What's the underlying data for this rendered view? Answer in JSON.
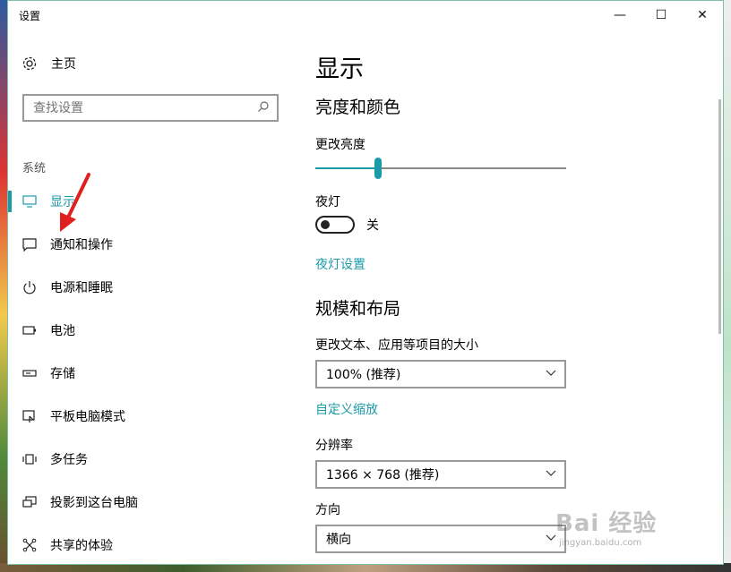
{
  "window": {
    "title": "设置",
    "controls": {
      "minimize": "—",
      "maximize": "☐",
      "close": "✕"
    }
  },
  "nav": {
    "home": {
      "label": "主页",
      "icon": "gear-icon"
    },
    "search": {
      "placeholder": "查找设置",
      "icon": "search-icon"
    },
    "section": "系统",
    "items": [
      {
        "label": "显示",
        "icon": "monitor-icon",
        "active": true
      },
      {
        "label": "通知和操作",
        "icon": "chat-bubble-icon"
      },
      {
        "label": "电源和睡眠",
        "icon": "power-icon"
      },
      {
        "label": "电池",
        "icon": "battery-icon"
      },
      {
        "label": "存储",
        "icon": "storage-icon"
      },
      {
        "label": "平板电脑模式",
        "icon": "tablet-icon"
      },
      {
        "label": "多任务",
        "icon": "multitask-icon"
      },
      {
        "label": "投影到这台电脑",
        "icon": "project-icon"
      },
      {
        "label": "共享的体验",
        "icon": "share-icon"
      }
    ]
  },
  "content": {
    "title": "显示",
    "brightness_color": {
      "heading": "亮度和颜色",
      "brightness_label": "更改亮度",
      "brightness_value": 0.25,
      "night_light_label": "夜灯",
      "night_light_state": "关",
      "night_light_link": "夜灯设置"
    },
    "scale_layout": {
      "heading": "规模和布局",
      "scale_label": "更改文本、应用等项目的大小",
      "scale_value": "100% (推荐)",
      "custom_scale_link": "自定义缩放",
      "resolution_label": "分辨率",
      "resolution_value": "1366 × 768 (推荐)",
      "orientation_label": "方向",
      "orientation_value": "横向"
    }
  },
  "watermark": {
    "brand": "Bai 经验",
    "url": "jingyan.baidu.com"
  },
  "colors": {
    "accent": "#1b9aaa",
    "annotation": "#e02020"
  }
}
